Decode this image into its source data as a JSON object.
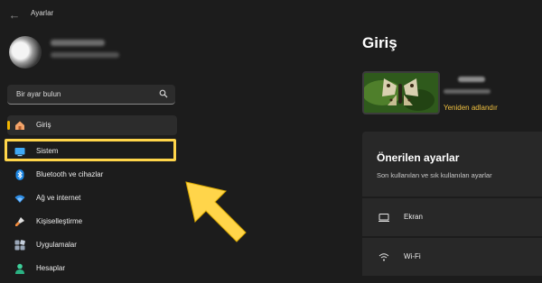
{
  "window": {
    "title": "Ayarlar",
    "back_glyph": "←"
  },
  "search": {
    "placeholder": "Bir ayar bulun",
    "icon": "search-icon"
  },
  "sidebar": {
    "items": [
      {
        "label": "Giriş",
        "icon": "home-icon",
        "active": true
      },
      {
        "label": "Sistem",
        "icon": "monitor-icon",
        "active": false
      },
      {
        "label": "Bluetooth ve cihazlar",
        "icon": "bluetooth-icon",
        "active": false
      },
      {
        "label": "Ağ ve internet",
        "icon": "wifi-icon",
        "active": false
      },
      {
        "label": "Kişiselleştirme",
        "icon": "brush-icon",
        "active": false
      },
      {
        "label": "Uygulamalar",
        "icon": "apps-icon",
        "active": false
      },
      {
        "label": "Hesaplar",
        "icon": "person-icon",
        "active": false
      }
    ]
  },
  "main": {
    "title": "Giriş",
    "device": {
      "rename_label": "Yeniden adlandır"
    },
    "recommended": {
      "title": "Önerilen ayarlar",
      "subtitle": "Son kullanılan ve sık kullanılan ayarlar",
      "items": [
        {
          "label": "Ekran",
          "icon": "display-icon"
        },
        {
          "label": "Wi-Fi",
          "icon": "wifi-icon"
        }
      ]
    }
  },
  "colors": {
    "accent": "#f0b400",
    "highlight": "#ffd54a",
    "link": "#f0c040",
    "background": "#1c1c1c",
    "card": "#282828"
  }
}
